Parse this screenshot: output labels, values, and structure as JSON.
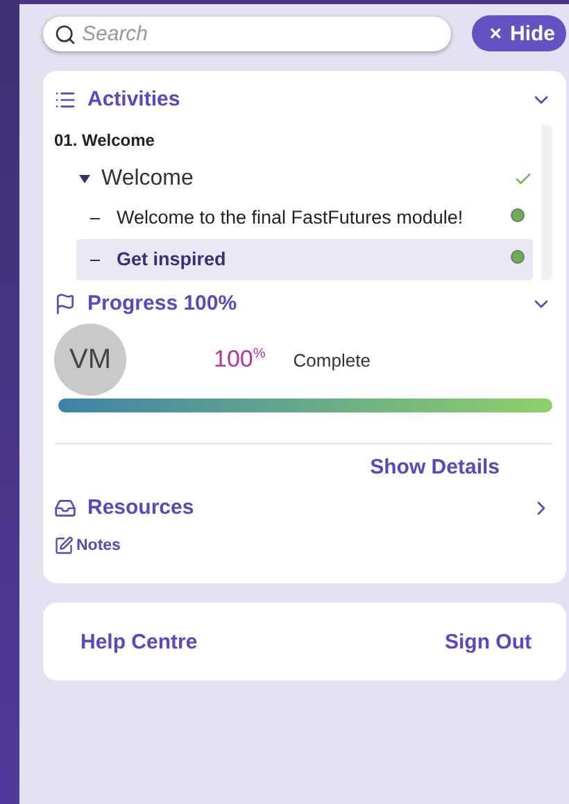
{
  "search": {
    "placeholder": "Search"
  },
  "hide_button": {
    "icon": "×",
    "label": "Hide"
  },
  "activities": {
    "title": "Activities",
    "expanded": true,
    "groups": [
      {
        "title": "01. Welcome",
        "children": [
          {
            "label": "Welcome",
            "expanded": true,
            "complete": true,
            "children": [
              {
                "label": "Welcome to the final FastFutures module!",
                "selected": false,
                "complete": true
              },
              {
                "label": "Get inspired",
                "selected": true,
                "complete": true
              }
            ]
          }
        ]
      }
    ]
  },
  "progress": {
    "title": "Progress 100%",
    "expanded": true,
    "avatar": "VM",
    "percent": "100$^{%}$",
    "status": "Complete",
    "level": 1.0,
    "details_link": "Show Details"
  },
  "resources": {
    "title": "Resources",
    "expanded": false
  },
  "notes": {
    "label": "Notes"
  },
  "footer": {
    "links": [
      "Help Centre",
      "Sign Out"
    ]
  }
}
